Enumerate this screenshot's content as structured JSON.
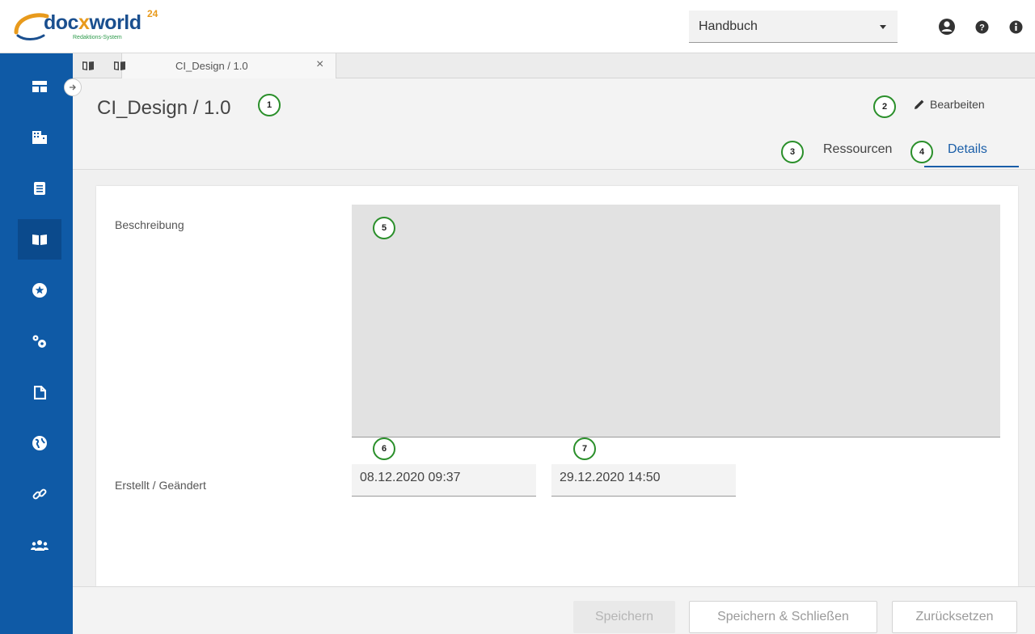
{
  "header": {
    "logo": {
      "brand_left": "doc",
      "brand_x": "x",
      "brand_right": "world",
      "brand_sup": "24",
      "tagline": "Redaktions-System"
    },
    "manual_select_value": "Handbuch",
    "icons": [
      "account-icon",
      "help-icon",
      "info-icon"
    ]
  },
  "sidebar": {
    "items": [
      {
        "name": "dashboard-icon"
      },
      {
        "name": "organization-icon"
      },
      {
        "name": "document-icon"
      },
      {
        "name": "manual-book-icon",
        "active": true
      },
      {
        "name": "star-icon"
      },
      {
        "name": "settings-gears-icon"
      },
      {
        "name": "file-icon"
      },
      {
        "name": "globe-icon"
      },
      {
        "name": "link-icon"
      },
      {
        "name": "users-icon"
      }
    ]
  },
  "tabbar": {
    "doc_tab_label": "CI_Design / 1.0",
    "close_label": "×"
  },
  "main": {
    "title": "CI_Design / 1.0",
    "edit_label": "Bearbeiten",
    "tabs": [
      {
        "label": "Ressourcen",
        "active": false
      },
      {
        "label": "Details",
        "active": true
      }
    ],
    "badges": [
      "1",
      "2",
      "3",
      "4",
      "5",
      "6",
      "7"
    ],
    "description_label": "Beschreibung",
    "created_changed_label": "Erstellt / Geändert",
    "created": "08.12.2020 09:37",
    "changed": "29.12.2020 14:50"
  },
  "footer": {
    "save": "Speichern",
    "save_close": "Speichern & Schließen",
    "reset": "Zurücksetzen"
  },
  "colors": {
    "sidebar": "#0f5aa6",
    "accent": "#1a5ea8",
    "badge_ring": "#2a8f2a",
    "logo_orange": "#e89a1c"
  }
}
